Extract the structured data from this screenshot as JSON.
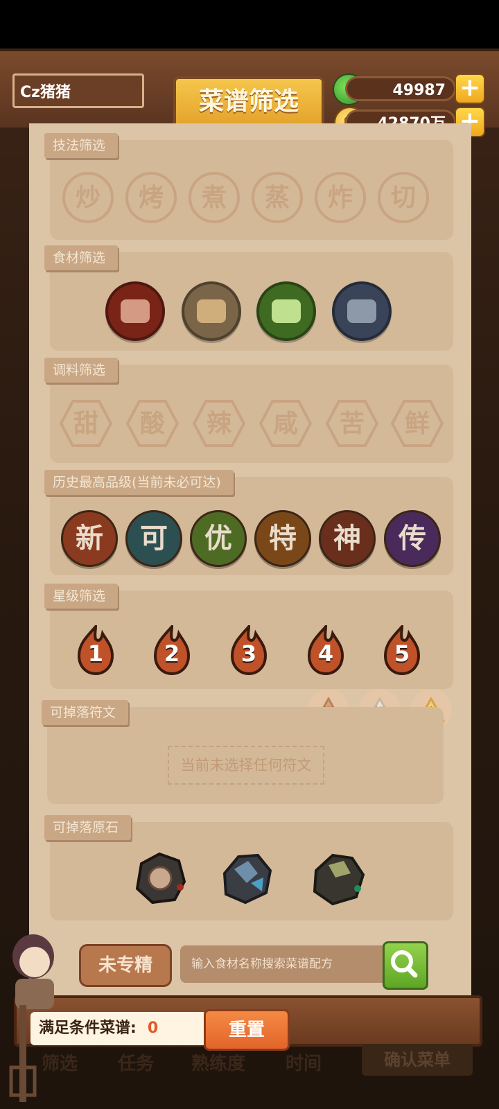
{
  "header": {
    "player_name": "Cz猪猪",
    "title": "菜谱筛选",
    "jade_amount": "49987",
    "coin_amount": "42870万",
    "add_symbol": "+"
  },
  "technique_filter": {
    "label": "技法筛选",
    "items": [
      "炒",
      "烤",
      "煮",
      "蒸",
      "炸",
      "切"
    ]
  },
  "ingredient_filter": {
    "label": "食材筛选",
    "items": [
      "meat-icon",
      "flour-icon",
      "cabbage-icon",
      "fish-icon"
    ]
  },
  "seasoning_filter": {
    "label": "调料筛选",
    "items": [
      "甜",
      "酸",
      "辣",
      "咸",
      "苦",
      "鲜"
    ]
  },
  "grade_filter": {
    "label": "历史最高品级(当前未必可达)",
    "items": [
      "新",
      "可",
      "优",
      "特",
      "神",
      "传"
    ],
    "colors": [
      "#8a3a1e",
      "#2c4f52",
      "#4e6b24",
      "#7a4818",
      "#6a2e1c",
      "#4a2a5a"
    ]
  },
  "star_filter": {
    "label": "星级筛选",
    "items": [
      "1",
      "2",
      "3",
      "4",
      "5"
    ]
  },
  "rune_filter": {
    "label": "可掉落符文",
    "metals": [
      "铜",
      "银",
      "金"
    ],
    "empty_text": "当前未选择任何符文"
  },
  "stone_filter": {
    "label": "可掉落原石",
    "items": [
      "red-ore-icon",
      "blue-ore-icon",
      "green-ore-icon"
    ]
  },
  "controls": {
    "unspecialized_label": "未专精",
    "search_placeholder": "输入食材名称搜索菜谱配方",
    "matching_label": "满足条件菜谱:",
    "matching_count": "0",
    "reset_label": "重置",
    "confirm_label": "确认菜单"
  },
  "bottom_nav": [
    "筛选",
    "任务",
    "熟练度",
    "时间"
  ]
}
